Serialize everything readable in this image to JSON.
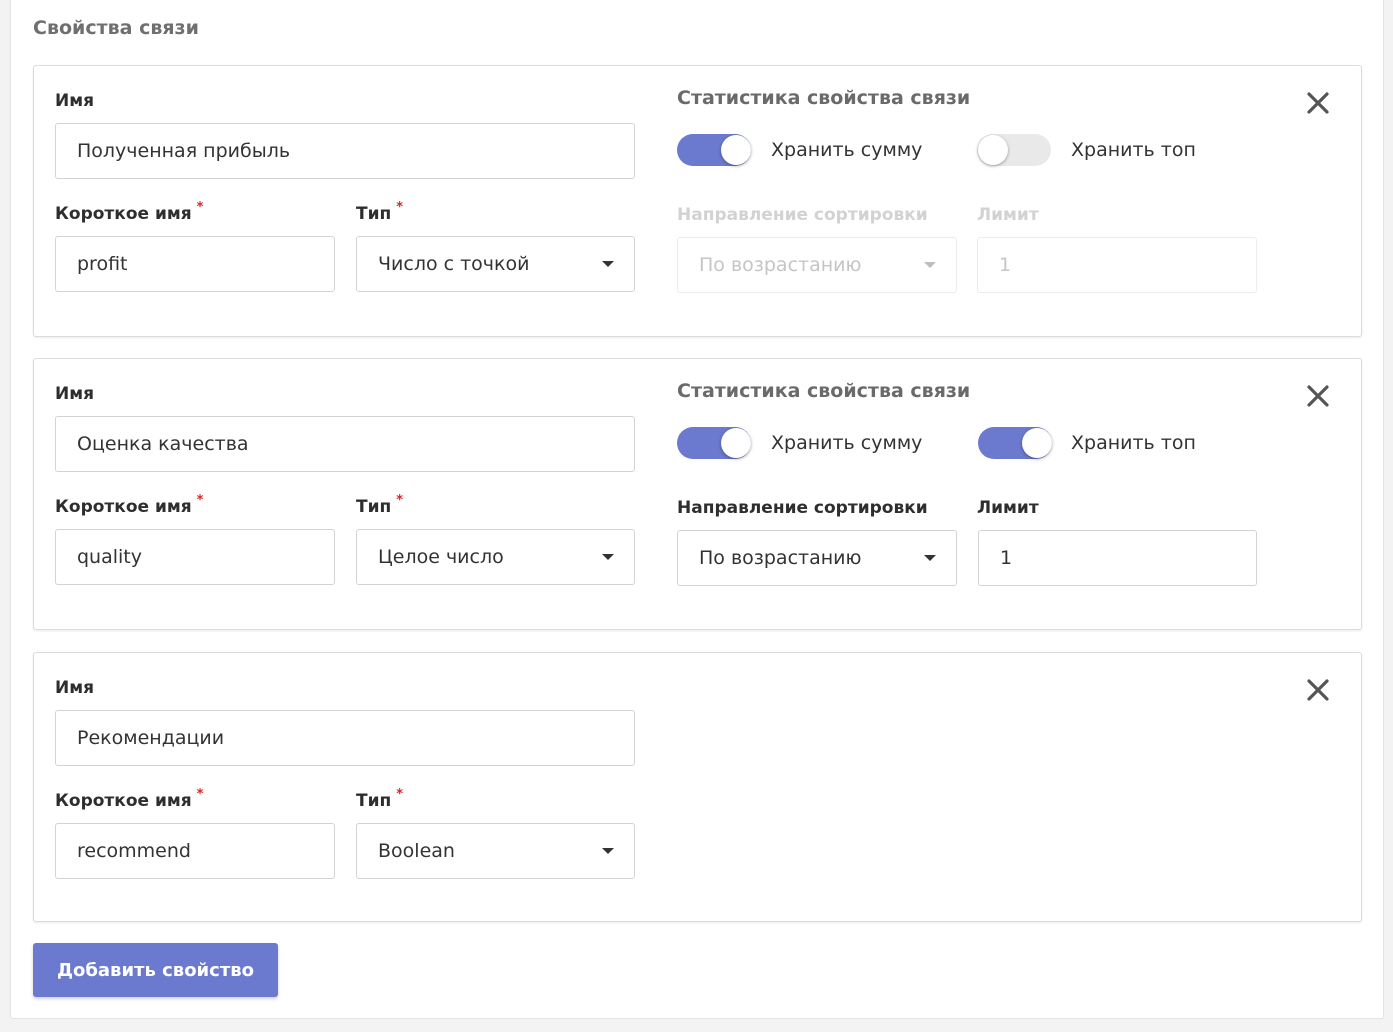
{
  "section_title": "Свойства связи",
  "labels": {
    "name": "Имя",
    "short_name": "Короткое имя",
    "type": "Тип",
    "required_mark": "*",
    "stats_title": "Статистика свойства связи",
    "store_sum": "Хранить сумму",
    "store_top": "Хранить топ",
    "sort_direction": "Направление сортировки",
    "limit": "Лимит"
  },
  "properties": [
    {
      "name": "Полученная прибыль",
      "short_name": "profit",
      "type": "Число с точкой",
      "store_sum": true,
      "store_top": false,
      "sort_direction": "По возрастанию",
      "limit": "1",
      "has_stats": true
    },
    {
      "name": "Оценка качества",
      "short_name": "quality",
      "type": "Целое число",
      "store_sum": true,
      "store_top": true,
      "sort_direction": "По возрастанию",
      "limit": "1",
      "has_stats": true
    },
    {
      "name": "Рекомендации",
      "short_name": "recommend",
      "type": "Boolean",
      "has_stats": false
    }
  ],
  "add_button_label": "Добавить свойство",
  "colors": {
    "accent": "#6b79cf",
    "required": "#dd2222"
  },
  "icons": {
    "close": "close-icon",
    "dropdown": "caret-down-icon"
  }
}
